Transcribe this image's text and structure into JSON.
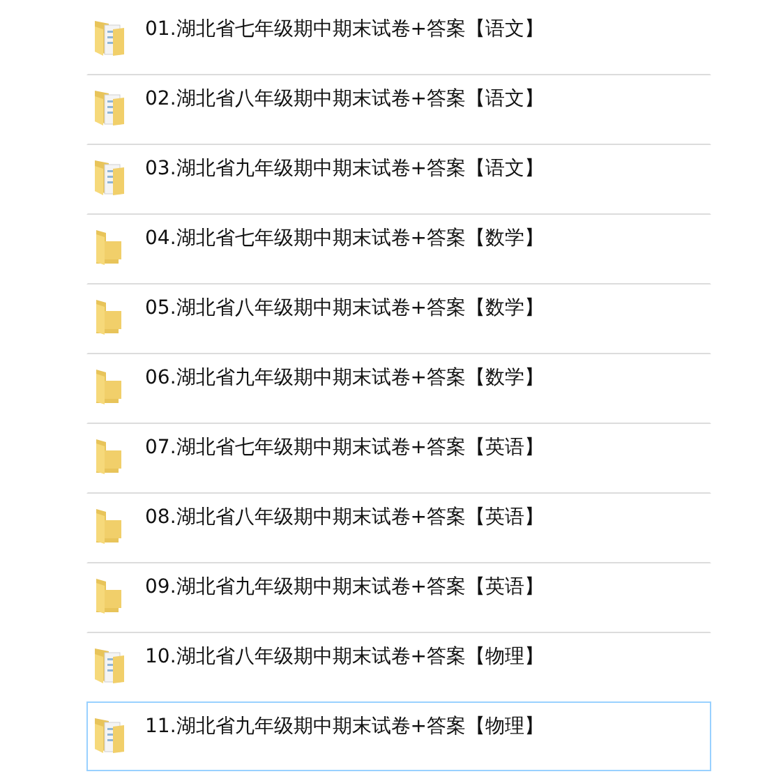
{
  "folders": [
    {
      "name": "01.湖北省七年级期中期末试卷+答案【语文】",
      "kind": "documents",
      "selected": false
    },
    {
      "name": "02.湖北省八年级期中期末试卷+答案【语文】",
      "kind": "documents",
      "selected": false
    },
    {
      "name": "03.湖北省九年级期中期末试卷+答案【语文】",
      "kind": "documents",
      "selected": false
    },
    {
      "name": "04.湖北省七年级期中期末试卷+答案【数学】",
      "kind": "empty",
      "selected": false
    },
    {
      "name": "05.湖北省八年级期中期末试卷+答案【数学】",
      "kind": "empty",
      "selected": false
    },
    {
      "name": "06.湖北省九年级期中期末试卷+答案【数学】",
      "kind": "empty",
      "selected": false
    },
    {
      "name": "07.湖北省七年级期中期末试卷+答案【英语】",
      "kind": "empty",
      "selected": false
    },
    {
      "name": "08.湖北省八年级期中期末试卷+答案【英语】",
      "kind": "empty",
      "selected": false
    },
    {
      "name": "09.湖北省九年级期中期末试卷+答案【英语】",
      "kind": "empty",
      "selected": false
    },
    {
      "name": "10.湖北省八年级期中期末试卷+答案【物理】",
      "kind": "documents",
      "selected": false
    },
    {
      "name": "11.湖北省九年级期中期末试卷+答案【物理】",
      "kind": "documents",
      "selected": true
    }
  ]
}
